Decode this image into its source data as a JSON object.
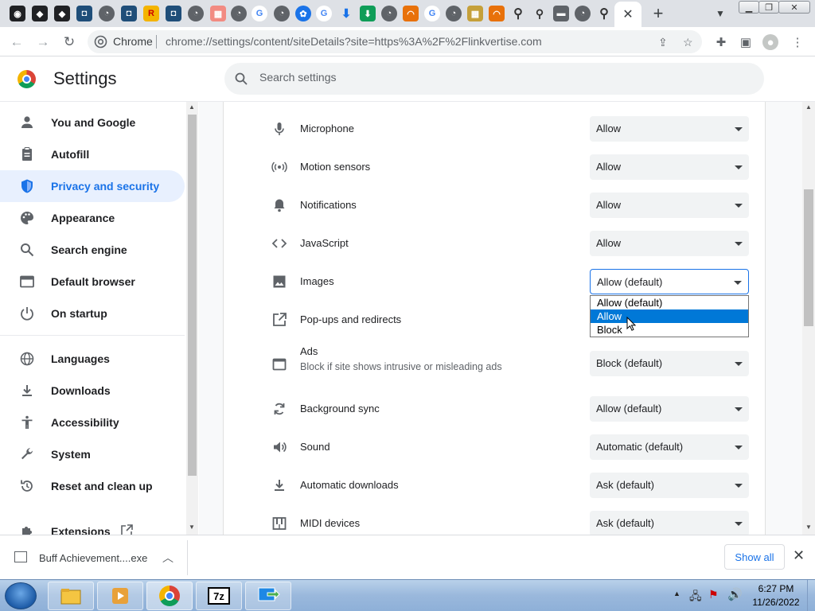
{
  "window": {
    "new_tab_label": "+",
    "close_tab_label": "✕"
  },
  "omnibox": {
    "site_label": "Chrome",
    "url": "chrome://settings/content/siteDetails?site=https%3A%2F%2Flinkvertise.com"
  },
  "header": {
    "title": "Settings",
    "search_placeholder": "Search settings"
  },
  "sidebar": {
    "items": [
      {
        "label": "You and Google",
        "icon": "person-icon"
      },
      {
        "label": "Autofill",
        "icon": "clipboard-icon"
      },
      {
        "label": "Privacy and security",
        "icon": "shield-icon",
        "active": true
      },
      {
        "label": "Appearance",
        "icon": "palette-icon"
      },
      {
        "label": "Search engine",
        "icon": "search-icon"
      },
      {
        "label": "Default browser",
        "icon": "browser-icon"
      },
      {
        "label": "On startup",
        "icon": "power-icon"
      },
      {
        "label": "Languages",
        "icon": "globe-icon"
      },
      {
        "label": "Downloads",
        "icon": "download-icon"
      },
      {
        "label": "Accessibility",
        "icon": "accessibility-icon"
      },
      {
        "label": "System",
        "icon": "wrench-icon"
      },
      {
        "label": "Reset and clean up",
        "icon": "reset-icon"
      },
      {
        "label": "Extensions",
        "icon": "puzzle-icon"
      }
    ]
  },
  "permissions": [
    {
      "label": "Microphone",
      "value": "Allow",
      "icon": "microphone-icon"
    },
    {
      "label": "Motion sensors",
      "value": "Allow",
      "icon": "motion-sensors-icon"
    },
    {
      "label": "Notifications",
      "value": "Allow",
      "icon": "bell-icon"
    },
    {
      "label": "JavaScript",
      "value": "Allow",
      "icon": "code-icon"
    },
    {
      "label": "Images",
      "value": "Allow (default)",
      "icon": "image-icon",
      "open": true
    },
    {
      "label": "Pop-ups and redirects",
      "value": "",
      "icon": "external-link-icon"
    },
    {
      "label": "Ads",
      "sublabel": "Block if site shows intrusive or misleading ads",
      "value": "Block (default)",
      "icon": "ads-icon"
    },
    {
      "label": "Background sync",
      "value": "Allow (default)",
      "icon": "sync-icon"
    },
    {
      "label": "Sound",
      "value": "Automatic (default)",
      "icon": "speaker-icon"
    },
    {
      "label": "Automatic downloads",
      "value": "Ask (default)",
      "icon": "download-icon"
    },
    {
      "label": "MIDI devices",
      "value": "Ask (default)",
      "icon": "piano-icon"
    }
  ],
  "images_dropdown": {
    "options": [
      "Allow (default)",
      "Allow",
      "Block"
    ],
    "highlighted": "Allow"
  },
  "download_bar": {
    "file_name": "Buff Achievement....exe",
    "show_all_label": "Show all"
  },
  "taskbar": {
    "time": "6:27 PM",
    "date": "11/26/2022",
    "apps": [
      "file-explorer-icon",
      "media-player-icon",
      "chrome-icon",
      "7zip-icon",
      "remote-desktop-icon"
    ]
  },
  "colors": {
    "accent": "#1a73e8",
    "active_bg": "#e8f0fe",
    "dropdown_highlight": "#0078d7"
  }
}
